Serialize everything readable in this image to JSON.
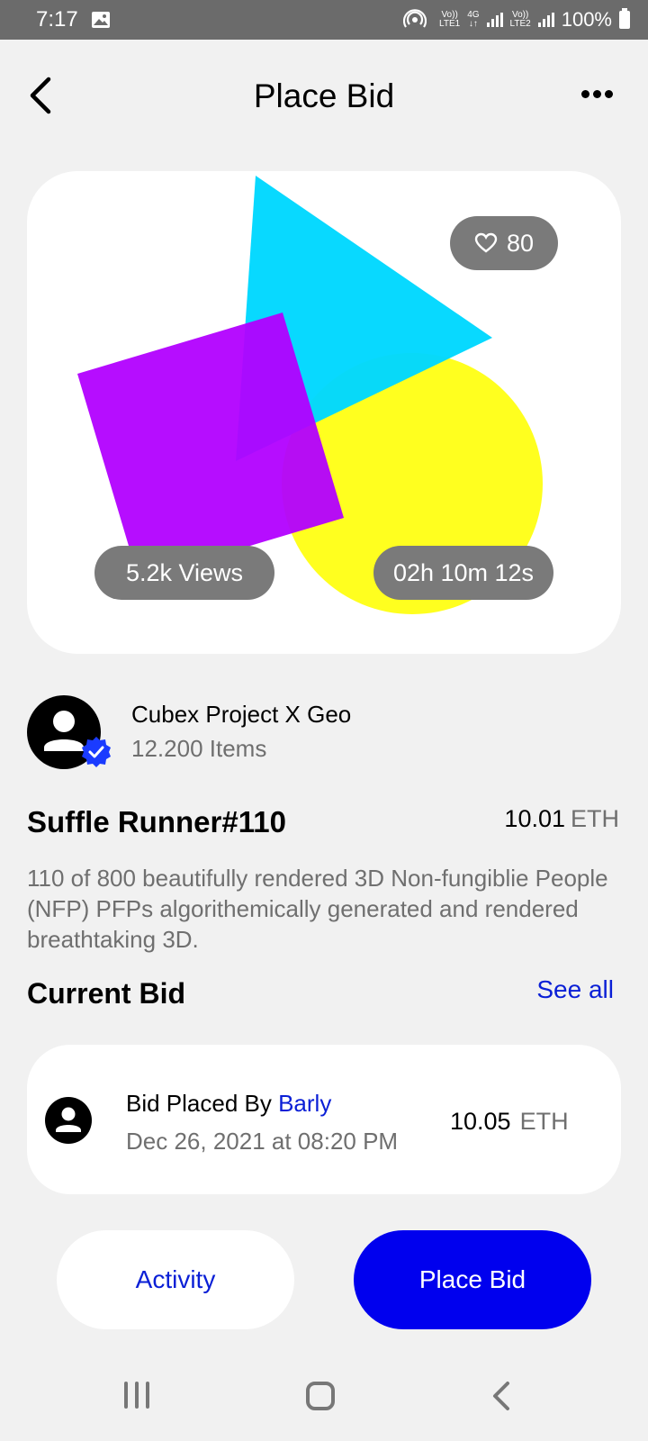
{
  "status_bar": {
    "time": "7:17",
    "sim1_label_top": "Vo))",
    "sim1_label_bottom": "LTE1",
    "net_label_top": "4G",
    "net_label_bottom": "↓↑",
    "sim2_label_top": "Vo))",
    "sim2_label_bottom": "LTE2",
    "battery": "100%",
    "icons": [
      "gallery-icon",
      "hotspot-icon",
      "signal-icon",
      "battery-icon"
    ]
  },
  "header": {
    "title": "Place Bid",
    "back_icon": "chevron-left-icon",
    "more_icon": "more-horizontal-icon"
  },
  "nft": {
    "likes": "80",
    "views": "5.2k Views",
    "time_left": "02h 10m 12s"
  },
  "creator": {
    "name": "Cubex Project X Geo",
    "items": "12.200 Items"
  },
  "item": {
    "title": "Suffle Runner#110",
    "price": "10.01",
    "price_unit": "ETH",
    "description": "110 of 800 beautifully rendered 3D Non-fungiblie People (NFP) PFPs algorithemically generated and rendered breathtaking 3D."
  },
  "current_bid": {
    "heading": "Current Bid",
    "see_all": "See all",
    "bid_prefix": "Bid Placed By ",
    "bidder": "Barly",
    "date": "Dec 26, 2021 at 08:20 PM",
    "amount": "10.05",
    "amount_unit": "ETH"
  },
  "actions": {
    "activity": "Activity",
    "place_bid": "Place Bid"
  },
  "colors": {
    "accent": "#0000ee",
    "link": "#0a1fd6",
    "background": "#f1f1f1",
    "pill": "#7a7a7a"
  }
}
